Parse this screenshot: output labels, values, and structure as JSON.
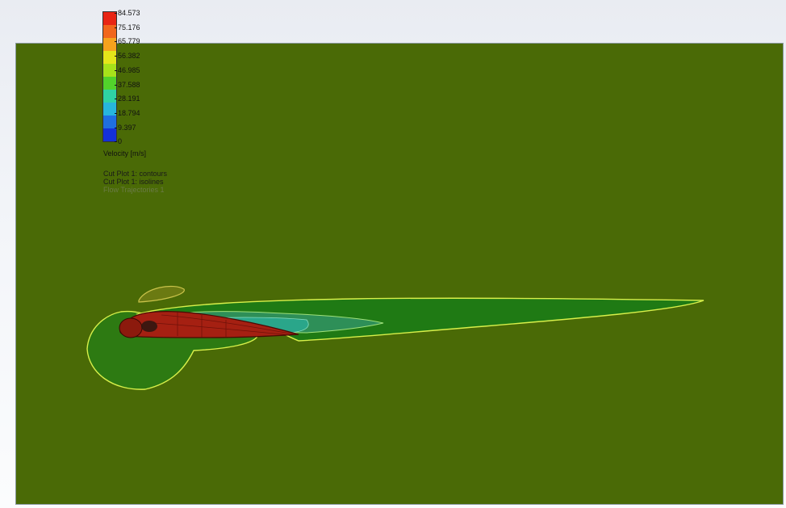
{
  "legend": {
    "ticks": [
      "84.573",
      "75.176",
      "65.779",
      "56.382",
      "46.985",
      "37.588",
      "28.191",
      "18.794",
      "9.397",
      "0"
    ],
    "colors": [
      "#e82514",
      "#f1661c",
      "#f5a21d",
      "#e4e61a",
      "#a7e21a",
      "#52d22b",
      "#2fd2a4",
      "#27b6dc",
      "#1f6fe0",
      "#1431d8"
    ],
    "title": "Velocity [m/s]"
  },
  "plots": [
    {
      "label": "Cut Plot 1: contours",
      "faded": false
    },
    {
      "label": "Cut Plot 1: isolines",
      "faded": false
    },
    {
      "label": "Flow Trajectories 1",
      "faded": true
    }
  ],
  "scene": {
    "background_color": "#4a6a06",
    "wake_color": "#2a7a10",
    "inner_color": "#2e8f58",
    "isoline_color": "#d8f04a",
    "body_color": "#a52012"
  }
}
